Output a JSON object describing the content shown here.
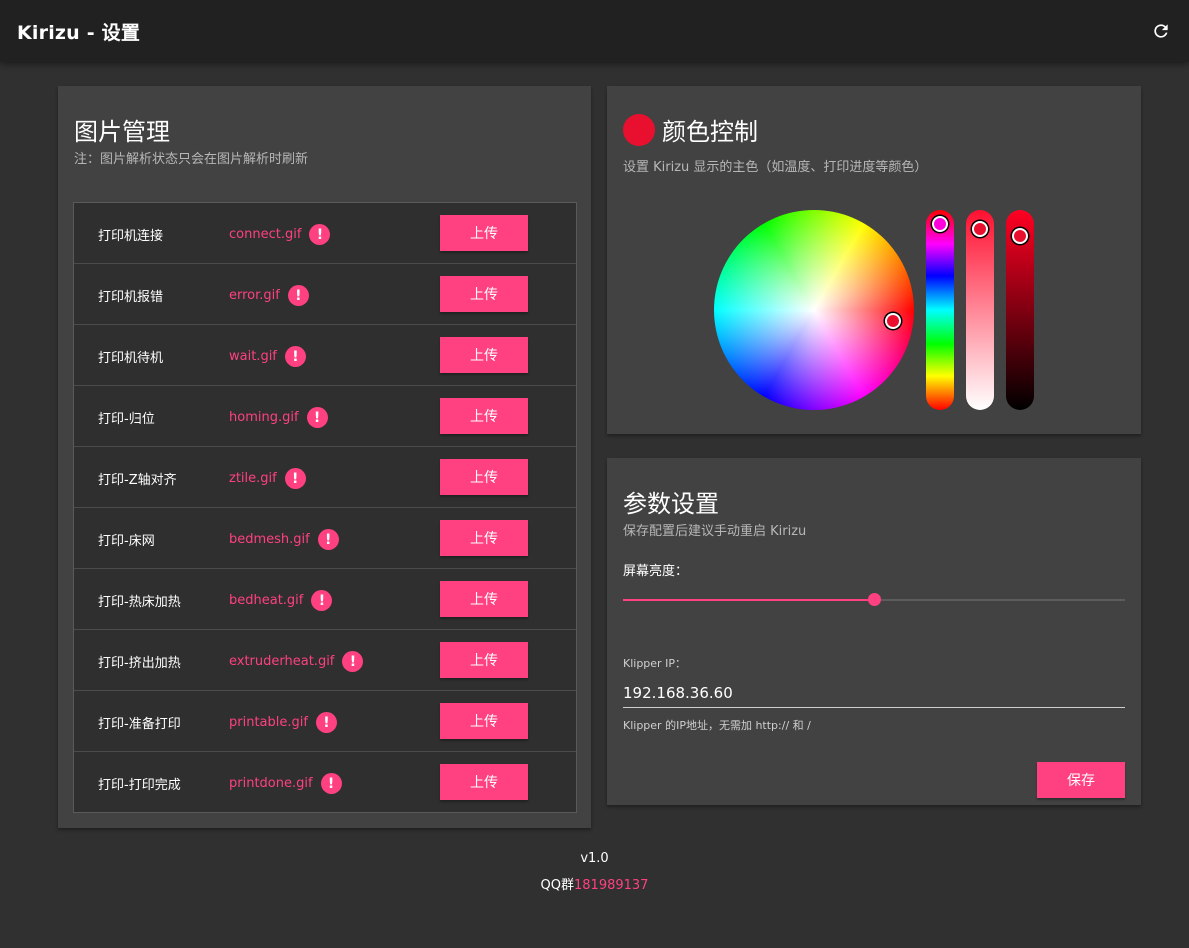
{
  "appbar": {
    "title": "Kirizu - 设置",
    "refresh_icon": "refresh-icon"
  },
  "image_card": {
    "title": "图片管理",
    "subtitle": "注：图片解析状态只会在图片解析时刷新",
    "upload_label": "上传",
    "warning_icon": "exclamation-circle-icon",
    "warning_symbol": "!",
    "rows": [
      {
        "label": "打印机连接",
        "file": "connect.gif",
        "button": "上传"
      },
      {
        "label": "打印机报错",
        "file": "error.gif",
        "button": "上传"
      },
      {
        "label": "打印机待机",
        "file": "wait.gif",
        "button": "上传"
      },
      {
        "label": "打印-归位",
        "file": "homing.gif",
        "button": "上传"
      },
      {
        "label": "打印-Z轴对齐",
        "file": "ztile.gif",
        "button": "上传"
      },
      {
        "label": "打印-床网",
        "file": "bedmesh.gif",
        "button": "上传"
      },
      {
        "label": "打印-热床加热",
        "file": "bedheat.gif",
        "button": "上传"
      },
      {
        "label": "打印-挤出加热",
        "file": "extruderheat.gif",
        "button": "上传"
      },
      {
        "label": "打印-准备打印",
        "file": "printable.gif",
        "button": "上传"
      },
      {
        "label": "打印-打印完成",
        "file": "printdone.gif",
        "button": "上传"
      }
    ]
  },
  "color_card": {
    "title": "颜色控制",
    "subtitle": "设置 Kirizu 显示的主色（如温度、打印进度等颜色）",
    "selected_color": "#e8102e",
    "hue_deg": 352,
    "saturation": 0.95,
    "value": 0.91
  },
  "settings_card": {
    "title": "参数设置",
    "subtitle": "保存配置后建议手动重启 Kirizu",
    "brightness_label": "屏幕亮度：",
    "brightness_fraction": 0.5,
    "ip_label": "Klipper IP：",
    "ip_value": "192.168.36.60",
    "ip_hint": "Klipper 的IP地址，无需加 http:// 和 /",
    "save_label": "保存"
  },
  "footer": {
    "version": "v1.0",
    "qq_label": "QQ群",
    "qq_number": "181989137"
  },
  "colors": {
    "accent": "#ff4081",
    "background": "#303030",
    "card": "#424242",
    "appbar": "#212121"
  }
}
